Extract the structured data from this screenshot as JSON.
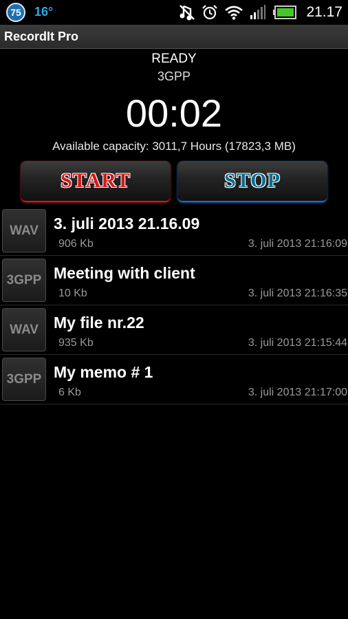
{
  "status_bar": {
    "badge": "75",
    "temperature": "16°",
    "time": "21.17",
    "icons": [
      "mute-icon",
      "alarm-icon",
      "wifi-icon",
      "signal-icon",
      "battery-icon"
    ]
  },
  "app": {
    "title": "RecordIt Pro"
  },
  "recorder": {
    "state": "READY",
    "format": "3GPP",
    "timer": "00:02",
    "capacity": "Available capacity: 3011,7 Hours (17823,3 MB)"
  },
  "buttons": {
    "start": "START",
    "stop": "STOP",
    "start_color": "#d21a1a",
    "stop_color": "#0d6b8f"
  },
  "recordings": [
    {
      "type": "WAV",
      "name": "3. juli 2013 21.16.09",
      "size": "906 Kb",
      "date": "3. juli 2013 21:16:09"
    },
    {
      "type": "3GPP",
      "name": "Meeting with client",
      "size": "10 Kb",
      "date": "3. juli 2013 21:16:35"
    },
    {
      "type": "WAV",
      "name": "My file nr.22",
      "size": "935 Kb",
      "date": "3. juli 2013 21:15:44"
    },
    {
      "type": "3GPP",
      "name": "My memo # 1",
      "size": "6 Kb",
      "date": "3. juli 2013 21:17:00"
    }
  ]
}
